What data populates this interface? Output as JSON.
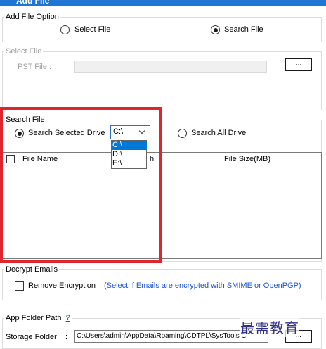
{
  "window": {
    "title": "Add File"
  },
  "add_file_option": {
    "label": "Add File Option",
    "select_file_label": "Select File",
    "search_file_label": "Search File",
    "selected": "search_file"
  },
  "select_file_group": {
    "label": "Select File",
    "pst_file_label": "PST File :",
    "pst_file_value": "",
    "browse_label": "..."
  },
  "search_file_group": {
    "label": "Search File",
    "search_selected_drive_label": "Search Selected Drive",
    "search_all_drive_label": "Search All Drive",
    "selected": "search_selected_drive",
    "drive_combo": {
      "value": "C:\\",
      "options": [
        "C:\\",
        "D:\\",
        "E:\\"
      ],
      "highlighted": "C:\\"
    }
  },
  "file_grid": {
    "columns": [
      {
        "label": "File Name"
      },
      {
        "label": "Path"
      },
      {
        "label": "File Size(MB)"
      }
    ],
    "visible_path_fragment": "h",
    "rows": []
  },
  "decrypt_emails": {
    "label": "Decrypt Emails",
    "remove_encryption_label": "Remove Encryption",
    "info_text": "(Select if Emails are encrypted with SMIME or OpenPGP)",
    "checked": false
  },
  "app_folder": {
    "label": "App Folder Path",
    "help_label": "?",
    "storage_folder_label": "Storage Folder",
    "separator": ":",
    "storage_folder_value": "C:\\Users\\admin\\AppData\\Roaming\\CDTPL\\SysTools C",
    "browse_label": "..."
  },
  "watermark": {
    "text": "最需教育"
  },
  "colors": {
    "title_bar": "#1f75d3",
    "highlight": "#0078d7",
    "red_frame": "#e0262d",
    "link": "#1a55d3"
  }
}
